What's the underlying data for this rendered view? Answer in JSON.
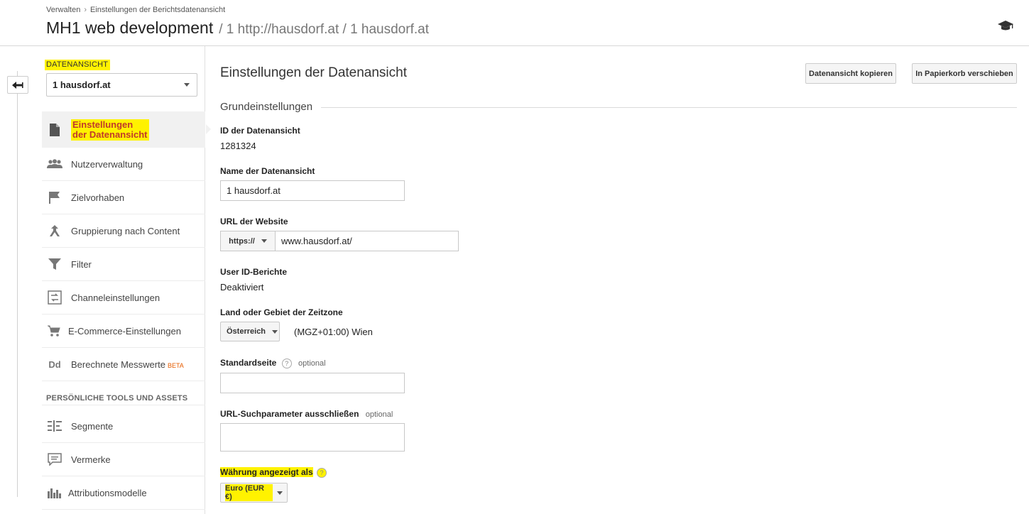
{
  "header": {
    "breadcrumb": [
      "Verwalten",
      "Einstellungen der Berichtsdatenansicht"
    ],
    "breadcrumb_sep": "›",
    "title": "MH1 web development",
    "subtitle": "/ 1 http://hausdorf.at / 1 hausdorf.at",
    "help_icon": "graduation-cap-icon"
  },
  "sidebar": {
    "view_label": "DATENANSICHT",
    "view_selected": "1 hausdorf.at",
    "items": [
      {
        "label": "Einstellungen der Datenansicht",
        "icon": "document-icon",
        "active": true
      },
      {
        "label": "Nutzerverwaltung",
        "icon": "users-icon"
      },
      {
        "label": "Zielvorhaben",
        "icon": "flag-icon"
      },
      {
        "label": "Gruppierung nach Content",
        "icon": "content-grouping-icon"
      },
      {
        "label": "Filter",
        "icon": "filter-icon"
      },
      {
        "label": "Channeleinstellungen",
        "icon": "channel-icon"
      },
      {
        "label": "E-Commerce-Einstellungen",
        "icon": "cart-icon"
      },
      {
        "label": "Berechnete Messwerte",
        "icon": "dd-icon",
        "badge": "BETA"
      }
    ],
    "section_personal": "PERSÖNLICHE TOOLS UND ASSETS",
    "personal_items": [
      {
        "label": "Segmente",
        "icon": "segments-icon"
      },
      {
        "label": "Vermerke",
        "icon": "annotations-icon"
      },
      {
        "label": "Attributionsmodelle",
        "icon": "attribution-icon"
      }
    ]
  },
  "main": {
    "title": "Einstellungen der Datenansicht",
    "copy_button": "Datenansicht kopieren",
    "trash_button": "In Papierkorb verschieben",
    "section": "Grundeinstellungen",
    "view_id_label": "ID der Datenansicht",
    "view_id_value": "1281324",
    "view_name_label": "Name der Datenansicht",
    "view_name_value": "1 hausdorf.at",
    "url_label": "URL der Website",
    "url_protocol": "https://",
    "url_value": "www.hausdorf.at/",
    "userid_label": "User ID-Berichte",
    "userid_value": "Deaktiviert",
    "tz_label": "Land oder Gebiet der Zeitzone",
    "tz_country": "Österreich",
    "tz_value": "(MGZ+01:00) Wien",
    "default_page_label": "Standardseite",
    "optional": "optional",
    "default_page_value": "",
    "exclude_label": "URL-Suchparameter ausschließen",
    "exclude_value": "",
    "currency_label": "Währung angezeigt als",
    "currency_value": "Euro (EUR €)",
    "help_glyph": "?"
  }
}
